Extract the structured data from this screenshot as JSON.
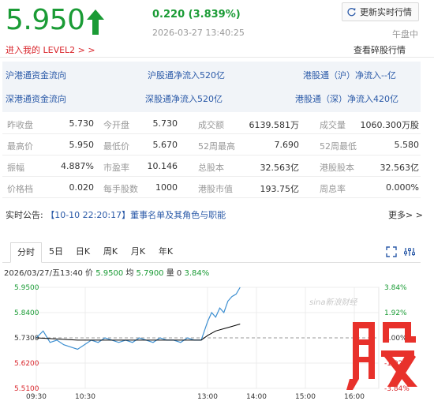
{
  "header": {
    "price": "5.950",
    "change": "0.220  (3.839%)",
    "datetime": "2026-03-27  13:40:25",
    "refresh_label": "更新实时行情",
    "market_status": "午盘中",
    "level2_link": "进入我的 LEVEL2 > >",
    "tick_link": "查看碎股行情",
    "price_color": "#1a9b35"
  },
  "flow": {
    "row1": [
      "沪港通资金流向",
      "沪股通净流入520亿",
      "港股通（沪）净流入--亿"
    ],
    "row2": [
      "深港通资金流向",
      "深股通净流入520亿",
      "港股通（深）净流入420亿"
    ]
  },
  "quote": {
    "rows": [
      [
        [
          "昨收盘",
          "5.730"
        ],
        [
          "今开盘",
          "5.730"
        ],
        [
          "成交额",
          "6139.581万"
        ],
        [
          "成交量",
          "1060.300万股"
        ]
      ],
      [
        [
          "最高价",
          "5.950"
        ],
        [
          "最低价",
          "5.670"
        ],
        [
          "52周最高",
          "7.690"
        ],
        [
          "52周最低",
          "5.580"
        ]
      ],
      [
        [
          "振幅",
          "4.887%"
        ],
        [
          "市盈率",
          "10.146"
        ],
        [
          "总股本",
          "32.563亿"
        ],
        [
          "港股股本",
          "32.563亿"
        ]
      ],
      [
        [
          "价格档",
          "0.020"
        ],
        [
          "每手股数",
          "1000"
        ],
        [
          "港股市值",
          "193.75亿"
        ],
        [
          "周息率",
          "0.000%"
        ]
      ]
    ]
  },
  "announcement": {
    "label": "实时公告:",
    "link": "【10-10 22:20:17】董事名单及其角色与职能",
    "more": "更多> >"
  },
  "tabs": [
    "分时",
    "5日",
    "日K",
    "周K",
    "月K",
    "年K"
  ],
  "info_line": {
    "prefix": "2026/03/27/五13:40  价 ",
    "price": "5.9500",
    "mid1": "  均 ",
    "avg": "5.7900",
    "mid2": "  量 0  ",
    "pct": "3.84%"
  },
  "chart_data": {
    "type": "line",
    "title": "",
    "y_left_ticks": [
      "5.9500",
      "5.8400",
      "5.7300",
      "5.6200",
      "5.5100"
    ],
    "y_right_ticks": [
      "3.84%",
      "1.92%",
      "0.00%",
      "-1.92%",
      "-3.84%"
    ],
    "x_ticks": [
      "09:30",
      "10:30",
      "13:00",
      "14:00",
      "15:00",
      "16:00"
    ],
    "ylim": [
      5.51,
      5.95
    ],
    "prev_close": 5.73,
    "series": [
      {
        "color": "#3d8fd1",
        "x": [
          "09:30",
          "09:35",
          "09:40",
          "09:45",
          "09:50",
          "09:55",
          "10:00",
          "10:05",
          "10:10",
          "10:15",
          "10:20",
          "10:25",
          "10:30",
          "10:35",
          "10:40",
          "10:45",
          "10:50",
          "10:55",
          "11:00",
          "11:05",
          "11:10",
          "11:15",
          "11:20",
          "11:25",
          "11:30",
          "13:00",
          "13:05",
          "13:10",
          "13:15",
          "13:20",
          "13:25",
          "13:30",
          "13:35",
          "13:40"
        ],
        "values": [
          5.73,
          5.76,
          5.71,
          5.72,
          5.7,
          5.69,
          5.68,
          5.7,
          5.72,
          5.71,
          5.73,
          5.72,
          5.71,
          5.72,
          5.71,
          5.73,
          5.72,
          5.71,
          5.73,
          5.72,
          5.72,
          5.71,
          5.73,
          5.72,
          5.72,
          5.8,
          5.84,
          5.82,
          5.86,
          5.84,
          5.89,
          5.91,
          5.92,
          5.95
        ]
      },
      {
        "color": "#000000",
        "x": [
          "09:30",
          "10:00",
          "10:30",
          "11:00",
          "11:30",
          "13:00",
          "13:10",
          "13:20",
          "13:30",
          "13:40"
        ],
        "values": [
          5.73,
          5.72,
          5.72,
          5.72,
          5.72,
          5.74,
          5.76,
          5.77,
          5.78,
          5.79
        ]
      }
    ],
    "watermark": "sina新浪财经",
    "grid": true
  }
}
